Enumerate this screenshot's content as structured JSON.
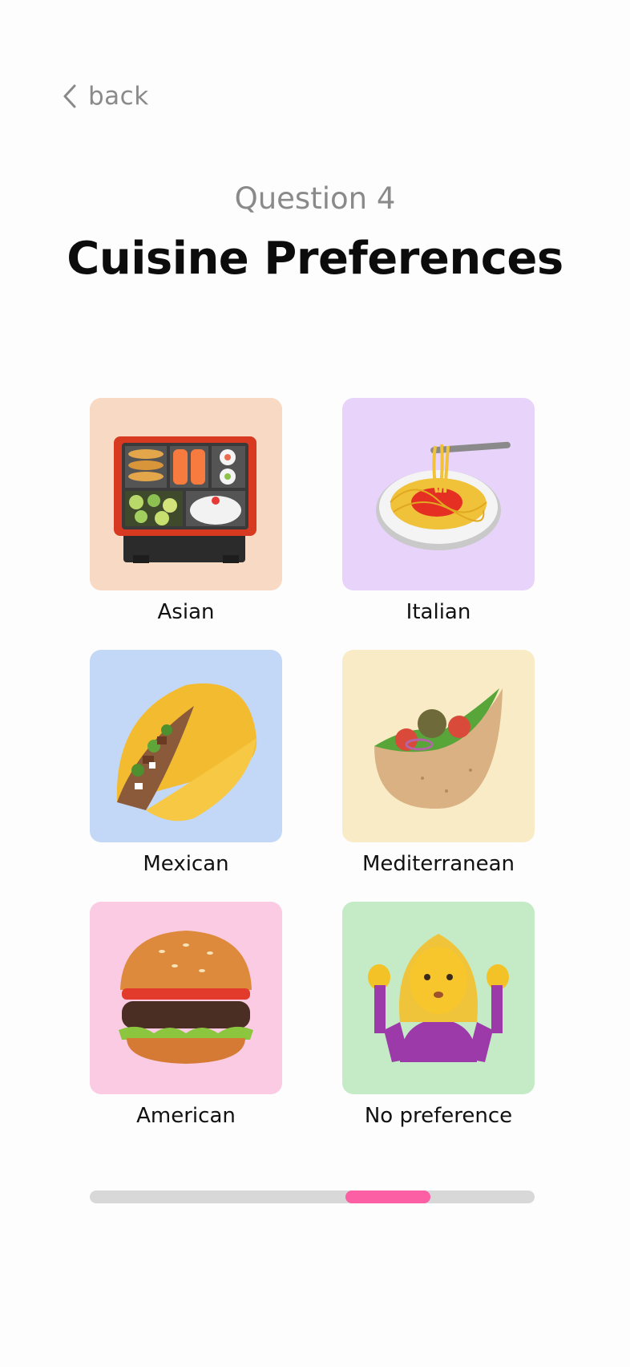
{
  "nav": {
    "back_label": "back",
    "back_icon": "chevron-left-icon"
  },
  "header": {
    "question_label": "Question 4",
    "title": "Cuisine Preferences"
  },
  "options": [
    {
      "label": "Asian",
      "icon": "bento-box-icon",
      "bg": "#f8d9c3"
    },
    {
      "label": "Italian",
      "icon": "spaghetti-icon",
      "bg": "#e8d3fb"
    },
    {
      "label": "Mexican",
      "icon": "taco-icon",
      "bg": "#c3d8f6"
    },
    {
      "label": "Mediterranean",
      "icon": "stuffed-flatbread-icon",
      "bg": "#f8ebc6"
    },
    {
      "label": "American",
      "icon": "hamburger-icon",
      "bg": "#fbcbe3"
    },
    {
      "label": "No preference",
      "icon": "person-shrugging-icon",
      "bg": "#c4ebc6"
    }
  ],
  "progress": {
    "segment_start": 0.575,
    "segment_end": 0.765,
    "fill_color": "#fd5fa4",
    "track_color": "#d8d8d8"
  }
}
